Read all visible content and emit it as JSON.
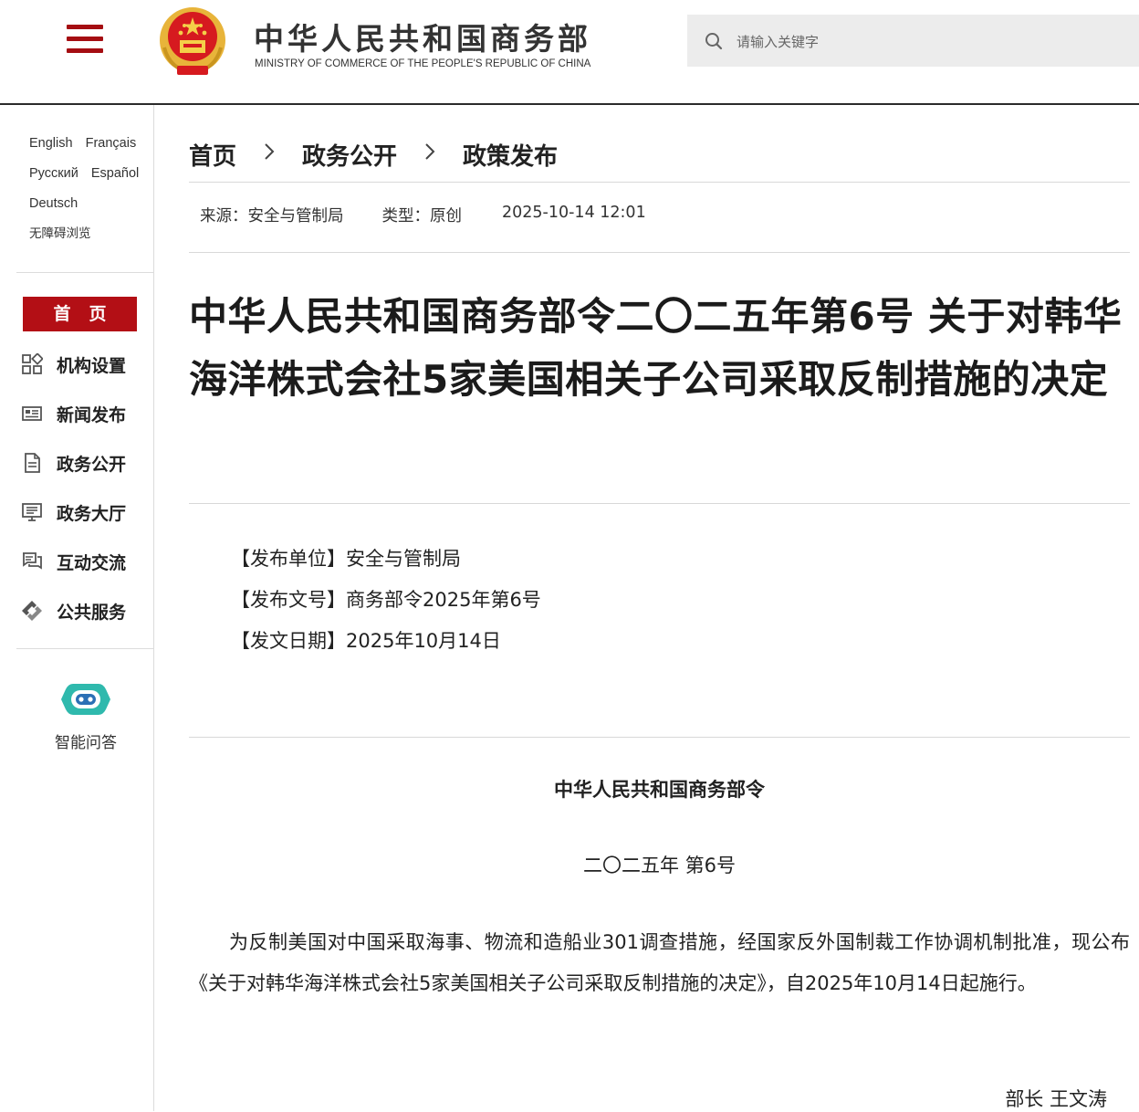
{
  "header": {
    "logo_cn": "中华人民共和国商务部",
    "logo_en": "MINISTRY OF COMMERCE OF THE PEOPLE'S REPUBLIC OF CHINA",
    "search": {
      "placeholder": "请输入关键字"
    },
    "colors": {
      "brand_red": "#a50d12",
      "emblem_gold": "#e8b43a"
    }
  },
  "sidebar": {
    "languages": [
      "English",
      "Français",
      "Русский",
      "Español",
      "Deutsch"
    ],
    "accessibility": "无障碍浏览",
    "home": "首页",
    "nav": [
      {
        "label": "机构设置",
        "icon": "org-grid-icon"
      },
      {
        "label": "新闻发布",
        "icon": "newspaper-icon"
      },
      {
        "label": "政务公开",
        "icon": "document-icon"
      },
      {
        "label": "政务大厅",
        "icon": "monitor-icon"
      },
      {
        "label": "互动交流",
        "icon": "chat-icon"
      },
      {
        "label": "公共服务",
        "icon": "service-diamond-icon"
      }
    ],
    "assistant": {
      "label": "智能问答",
      "icon": "robot-icon"
    }
  },
  "breadcrumb": [
    "首页",
    "政务公开",
    "政策发布"
  ],
  "meta": {
    "source": "来源：安全与管制局",
    "type": "类型：原创",
    "datetime": "2025-10-14 12:01"
  },
  "article": {
    "title": "中华人民共和国商务部令二〇二五年第6号 关于对韩华海洋株式会社5家美国相关子公司采取反制措施的决定",
    "info": [
      "【发布单位】安全与管制局",
      "【发布文号】商务部令2025年第6号",
      "【发文日期】2025年10月14日"
    ],
    "order_title": "中华人民共和国商务部令",
    "order_number": "二〇二五年 第6号",
    "body": "为反制美国对中国采取海事、物流和造船业301调查措施，经国家反外国制裁工作协调机制批准，现公布《关于对韩华海洋株式会社5家美国相关子公司采取反制措施的决定》，自2025年10月14日起施行。",
    "signature": "部长 王文涛"
  }
}
